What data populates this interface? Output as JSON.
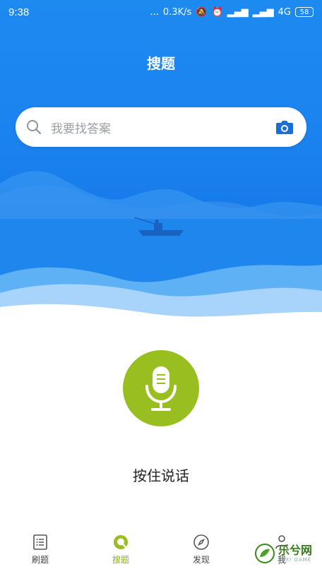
{
  "status_bar": {
    "time": "9:38",
    "dots": "...",
    "network_speed": "0.3K/s",
    "network_type": "4G",
    "battery": "58"
  },
  "header": {
    "title": "搜题"
  },
  "search": {
    "placeholder": "我要找答案"
  },
  "voice": {
    "hold_label": "按住说话"
  },
  "tabbar": {
    "tabs": [
      {
        "label": "刷题",
        "icon": "list-icon",
        "active": false
      },
      {
        "label": "搜题",
        "icon": "search-tab-icon",
        "active": true
      },
      {
        "label": "发现",
        "icon": "compass-icon",
        "active": false
      },
      {
        "label": "我",
        "icon": "person-icon",
        "active": false
      }
    ]
  },
  "watermark": {
    "text": "乐兮网",
    "sub": "LEXI GAME"
  },
  "colors": {
    "hero_blue": "#1b83ef",
    "mic_green": "#98bf1f",
    "active_tab": "#89b41a"
  }
}
